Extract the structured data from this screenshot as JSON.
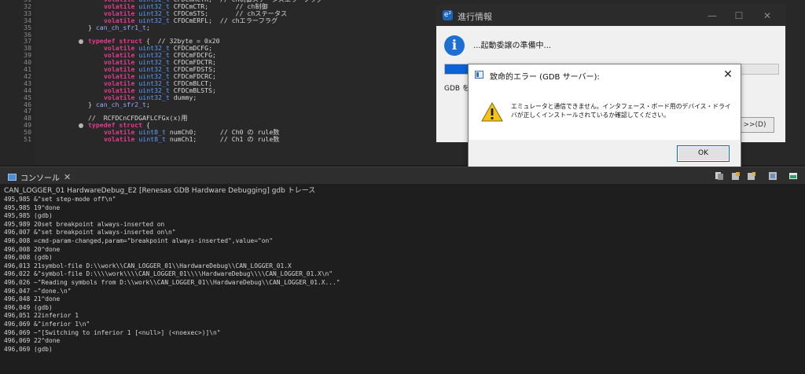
{
  "editor": {
    "lines": [
      {
        "num": "31",
        "fold": false,
        "parts": [
          [
            "k",
            "volatile"
          ],
          [
            "i",
            " "
          ],
          [
            "t",
            "uint32_t"
          ],
          [
            "i",
            " CFDCmRCTR;  // ch制御ステータスエラーフラグ"
          ]
        ]
      },
      {
        "num": "32",
        "fold": false,
        "parts": [
          [
            "k",
            "volatile"
          ],
          [
            "i",
            " "
          ],
          [
            "t",
            "uint32_t"
          ],
          [
            "i",
            " CFDCmCTR;       "
          ],
          [
            "c",
            "// ch制御"
          ]
        ]
      },
      {
        "num": "33",
        "fold": false,
        "parts": [
          [
            "k",
            "volatile"
          ],
          [
            "i",
            " "
          ],
          [
            "t",
            "uint32_t"
          ],
          [
            "i",
            " CFDCmSTS;       "
          ],
          [
            "c",
            "// chステータス"
          ]
        ]
      },
      {
        "num": "34",
        "fold": false,
        "parts": [
          [
            "k",
            "volatile"
          ],
          [
            "i",
            " "
          ],
          [
            "t",
            "uint32_t"
          ],
          [
            "i",
            " CFDCmERFL;  "
          ],
          [
            "c",
            "// chエラーフラグ"
          ]
        ]
      },
      {
        "num": "35",
        "fold": false,
        "indent": 1,
        "parts": [
          [
            "i",
            "} "
          ],
          [
            "n",
            "can_ch_sfr1_t"
          ],
          [
            "i",
            ";"
          ]
        ]
      },
      {
        "num": "36",
        "fold": false,
        "parts": []
      },
      {
        "num": "37",
        "fold": true,
        "indent": 1,
        "parts": [
          [
            "k",
            "typedef struct"
          ],
          [
            "i",
            " {  "
          ],
          [
            "c",
            "// 32byte = 0x20"
          ]
        ]
      },
      {
        "num": "38",
        "fold": false,
        "parts": [
          [
            "k",
            "volatile"
          ],
          [
            "i",
            " "
          ],
          [
            "t",
            "uint32_t"
          ],
          [
            "i",
            " CFDCmDCFG;"
          ]
        ]
      },
      {
        "num": "39",
        "fold": false,
        "parts": [
          [
            "k",
            "volatile"
          ],
          [
            "i",
            " "
          ],
          [
            "t",
            "uint32_t"
          ],
          [
            "i",
            " CFDCmFDCFG;"
          ]
        ]
      },
      {
        "num": "40",
        "fold": false,
        "parts": [
          [
            "k",
            "volatile"
          ],
          [
            "i",
            " "
          ],
          [
            "t",
            "uint32_t"
          ],
          [
            "i",
            " CFDCmFDCTR;"
          ]
        ]
      },
      {
        "num": "41",
        "fold": false,
        "parts": [
          [
            "k",
            "volatile"
          ],
          [
            "i",
            " "
          ],
          [
            "t",
            "uint32_t"
          ],
          [
            "i",
            " CFDCmFDSTS;"
          ]
        ]
      },
      {
        "num": "42",
        "fold": false,
        "parts": [
          [
            "k",
            "volatile"
          ],
          [
            "i",
            " "
          ],
          [
            "t",
            "uint32_t"
          ],
          [
            "i",
            " CFDCmFDCRC;"
          ]
        ]
      },
      {
        "num": "43",
        "fold": false,
        "parts": [
          [
            "k",
            "volatile"
          ],
          [
            "i",
            " "
          ],
          [
            "t",
            "uint32_t"
          ],
          [
            "i",
            " CFDCmBLCT;"
          ]
        ]
      },
      {
        "num": "44",
        "fold": false,
        "parts": [
          [
            "k",
            "volatile"
          ],
          [
            "i",
            " "
          ],
          [
            "t",
            "uint32_t"
          ],
          [
            "i",
            " CFDCmBLSTS;"
          ]
        ]
      },
      {
        "num": "45",
        "fold": false,
        "parts": [
          [
            "k",
            "volatile"
          ],
          [
            "i",
            " "
          ],
          [
            "t",
            "uint32_t"
          ],
          [
            "i",
            " dummy;"
          ]
        ]
      },
      {
        "num": "46",
        "fold": false,
        "indent": 1,
        "parts": [
          [
            "i",
            "} "
          ],
          [
            "n",
            "can_ch_sfr2_t"
          ],
          [
            "i",
            ";"
          ]
        ]
      },
      {
        "num": "47",
        "fold": false,
        "parts": []
      },
      {
        "num": "48",
        "fold": false,
        "indent": 1,
        "parts": [
          [
            "c",
            "//  RCFDCnCFDGAFLCFGx(x)用"
          ]
        ]
      },
      {
        "num": "49",
        "fold": true,
        "indent": 1,
        "parts": [
          [
            "k",
            "typedef struct"
          ],
          [
            "i",
            " {"
          ]
        ]
      },
      {
        "num": "50",
        "fold": false,
        "parts": [
          [
            "k",
            "volatile"
          ],
          [
            "i",
            " "
          ],
          [
            "t",
            "uint8_t"
          ],
          [
            "i",
            " numCh0;      "
          ],
          [
            "c",
            "// Ch0 の rule数"
          ]
        ]
      },
      {
        "num": "51",
        "fold": false,
        "parts": [
          [
            "k",
            "volatile"
          ],
          [
            "i",
            " "
          ],
          [
            "t",
            "uint8_t"
          ],
          [
            "i",
            " numCh1;      "
          ],
          [
            "c",
            "// Ch1 の rule数"
          ]
        ]
      }
    ]
  },
  "progress_window": {
    "title": "進行情報",
    "app_icon": "e²",
    "minimize": "—",
    "maximize": "☐",
    "close": "✕",
    "message": "...起動委譲の準備中...",
    "detail": "GDB を",
    "progress_percent": 80,
    "details_label": ">>(D)"
  },
  "error_dialog": {
    "title": "致命的エラー (GDB サーバー):",
    "close": "✕",
    "message": "エミュレータと通信できません。インタフェース・ボード用のデバイス・ドライバが正しくインストールされているか確認してください。",
    "ok_label": "OK"
  },
  "console": {
    "tab_label": "コンソール",
    "tab_close": "✕",
    "subtitle": "CAN_LOGGER_01 HardwareDebug_E2 [Renesas GDB Hardware Debugging] gdb トレース",
    "lines": [
      "495,985 &\"set step-mode off\\n\"",
      "495,985 19^done",
      "495,985 (gdb)",
      "495,989 20set breakpoint always-inserted on",
      "496,007 &\"set breakpoint always-inserted on\\n\"",
      "496,008 =cmd-param-changed,param=\"breakpoint always-inserted\",value=\"on\"",
      "496,008 20^done",
      "496,008 (gdb)",
      "496,013 21symbol-file D:\\\\work\\\\CAN_LOGGER_01\\\\HardwareDebug\\\\CAN_LOGGER_01.X",
      "496,022 &\"symbol-file D:\\\\\\\\work\\\\\\\\CAN_LOGGER_01\\\\\\\\HardwareDebug\\\\\\\\CAN_LOGGER_01.X\\n\"",
      "496,026 ~\"Reading symbols from D:\\\\work\\\\CAN_LOGGER_01\\\\HardwareDebug\\\\CAN_LOGGER_01.X...\"",
      "496,047 ~\"done.\\n\"",
      "496,048 21^done",
      "496,049 (gdb)",
      "496,051 22inferior 1",
      "496,069 &\"inferior 1\\n\"",
      "496,069 ~\"[Switching to inferior 1 [<null>] (<noexec>)]\\n\"",
      "496,069 22^done",
      "496,069 (gdb)"
    ]
  },
  "colors": {
    "keyword": "#e33b8f",
    "type": "#5b9bff",
    "progress_fill": "#0a63d6",
    "warning": "#f3c317"
  }
}
